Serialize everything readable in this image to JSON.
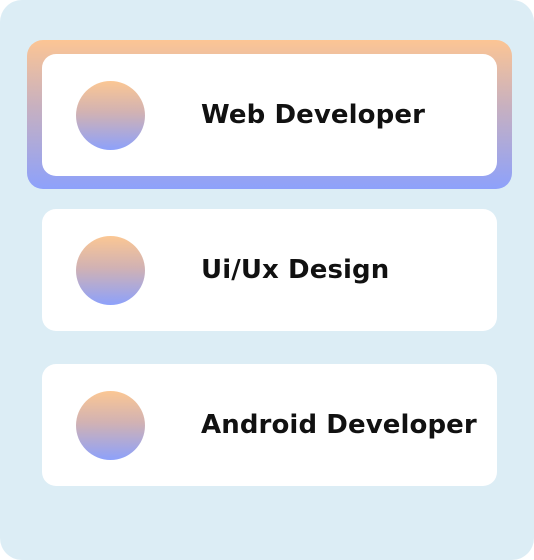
{
  "roles": {
    "items": [
      {
        "label": "Web Developer",
        "selected": true
      },
      {
        "label": "Ui/Ux Design",
        "selected": false
      },
      {
        "label": "Android Developer",
        "selected": false
      }
    ]
  },
  "colors": {
    "panel_background": "#dcedf5",
    "card_background": "#ffffff",
    "gradient_top": "#fcc594",
    "gradient_bottom": "#8da1fb",
    "text": "#111111"
  },
  "icons": {
    "avatar": "gradient-circle-icon"
  }
}
